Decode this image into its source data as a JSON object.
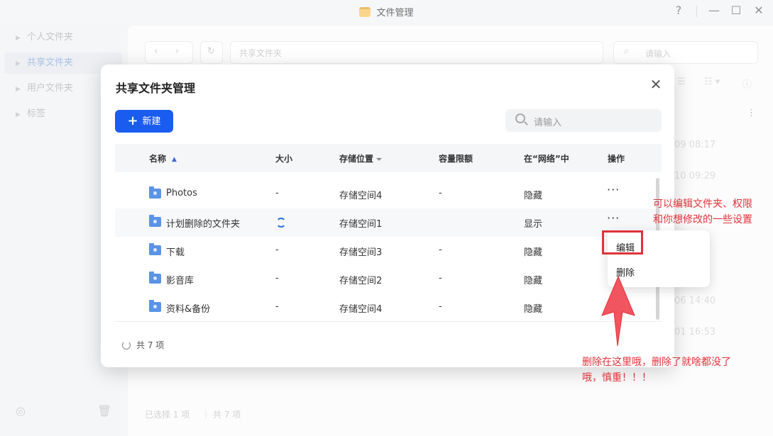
{
  "window": {
    "title": "文件管理",
    "controls": {
      "help": "?",
      "minimize": "—",
      "maximize": "☐",
      "close": "✕"
    }
  },
  "sidebar": {
    "items": [
      {
        "label": "个人文件夹",
        "active": false
      },
      {
        "label": "共享文件夹",
        "active": true
      },
      {
        "label": "用户文件夹",
        "active": false
      },
      {
        "label": "标签",
        "active": false
      }
    ]
  },
  "main": {
    "path": "共享文件夹",
    "search_placeholder": "请输入",
    "bg_times": [
      "09 08:17",
      "10 09:29",
      "06 14:40",
      "01 16:53"
    ],
    "status_selected": "已选择 1 项",
    "status_total": "共 7 项"
  },
  "modal": {
    "title": "共享文件夹管理",
    "new_button": "新建",
    "search_placeholder": "请输入",
    "columns": {
      "name": "名称",
      "size": "大小",
      "location": "存储位置",
      "quota": "容量限额",
      "network": "在“网络”中",
      "actions": "操作"
    },
    "rows": [
      {
        "name": "Photos",
        "size": "-",
        "location": "存储空间4",
        "quota": "-",
        "network": "隐藏",
        "syncing": false
      },
      {
        "name": "计划删除的文件夹",
        "size": "",
        "location": "存储空间1",
        "quota": "",
        "network": "显示",
        "syncing": true
      },
      {
        "name": "下载",
        "size": "-",
        "location": "存储空间3",
        "quota": "-",
        "network": "隐藏",
        "syncing": false
      },
      {
        "name": "影音库",
        "size": "-",
        "location": "存储空间2",
        "quota": "-",
        "network": "隐藏",
        "syncing": false
      },
      {
        "name": "资料&备份",
        "size": "-",
        "location": "存储空间4",
        "quota": "-",
        "network": "隐藏",
        "syncing": false
      }
    ],
    "actions_label": "···",
    "footer": "共 7 项"
  },
  "context_menu": {
    "edit": "编辑",
    "delete": "删除"
  },
  "annotations": {
    "top_line1": "可以编辑文件夹、权限",
    "top_line2": "和你想修改的一些设置",
    "bottom_line1": "删除在这里哦，删除了就啥都没了",
    "bottom_line2": "哦，慎重！！！"
  },
  "colors": {
    "accent": "#1a5cf0",
    "annotation_red": "#e0333a",
    "folder_blue": "#5b93e6"
  }
}
